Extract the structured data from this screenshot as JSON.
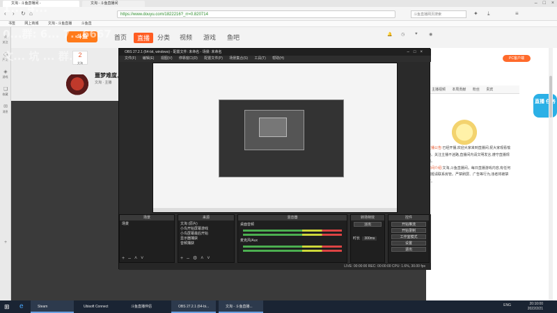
{
  "browser": {
    "tabs": [
      {
        "title": "文淘 - 斗鱼直播间 -"
      },
      {
        "title": "文淘 - 斗鱼直播间"
      }
    ],
    "url": "https://www.douyu.com/1822216?_rr=0.820714",
    "search_placeholder": "斗鱼直播网页搜索",
    "bookmarks": [
      "书签",
      "网上商城",
      "文淘 - 斗鱼直播",
      "斗鱼直"
    ]
  },
  "sidebar": {
    "items": [
      "关注",
      "历史",
      "游戏",
      "收藏",
      "消息"
    ]
  },
  "douyu": {
    "logo": "斗鱼",
    "nav": [
      "首页",
      "直播",
      "分类",
      "视频",
      "游戏",
      "鱼吧"
    ],
    "level": "2",
    "level_label": "文淘",
    "room_title": "噩梦难度,",
    "room_sub": "文淘 · 主播",
    "pc_button": "PC客户端",
    "panel_tabs": [
      "主播视频",
      "本周贡献",
      "粉丝",
      "贵宾"
    ],
    "badge": "直播 任务",
    "notice_label": "主播公告:",
    "notice_text": "已经开播,欢迎大家来到直播间,祝大家观看愉快。关注主播不迷路,直播间内请文明发言,遵守直播规范。",
    "notice_label2": "房间介绍:",
    "notice_text2": "文淘,斗鱼直播间。每日直播游戏内容,有任何问题请联系房管。严禁刷屏、广告等行为,违者将被禁言。"
  },
  "obs": {
    "title": "OBS 27.2.1 (64-bit, windows) - 配置文件: 未命名 - 场景: 未命名",
    "menu": [
      "文件(F)",
      "编辑(E)",
      "视图(V)",
      "停靠窗口(D)",
      "配置文件(P)",
      "场景集合(S)",
      "工具(T)",
      "帮助(H)"
    ],
    "docks": {
      "scenes": {
        "title": "场景",
        "items": [
          "场景"
        ]
      },
      "sources": {
        "title": "来源",
        "items": [
          "文淘 (原片)",
          "小鸟开始屏幕游戏",
          "小鸟屏幕最后开始",
          "显示器捕获",
          "音频捕获"
        ]
      },
      "mixer": {
        "title": "混音器",
        "channels": [
          "桌面音频",
          "麦克风/Aux"
        ]
      },
      "transitions": {
        "title": "转场特效",
        "type": "淡出",
        "duration_label": "时长",
        "duration": "300ms"
      },
      "controls": {
        "title": "控件",
        "buttons": [
          "开始推流",
          "开始录制",
          "工作室模式",
          "设置",
          "退出"
        ]
      }
    },
    "status": "LIVE: 00:00:00    REC: 00:00:00    CPU: 1.6%, 30.00 fps"
  },
  "taskbar": {
    "items": [
      "Steam",
      "Ubisoft Connect",
      "斗鱼直播伴侣",
      "OBS 27.2.1 (64-bi...",
      "文淘 - 斗鱼直播..."
    ],
    "lang": "ENG",
    "time": "20:10:00",
    "date": "2022/2/21"
  },
  "watermark": {
    "lines": [
      "1... 4...",
      "0...群: 6... 7...6667",
      "文... 坑 ... 群..."
    ]
  }
}
